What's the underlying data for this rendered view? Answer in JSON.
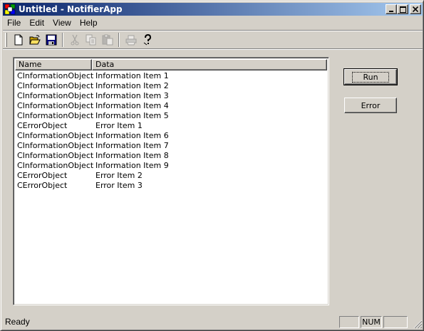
{
  "window": {
    "title": "Untitled - NotifierApp",
    "min_glyph": "_",
    "max_glyph": "□",
    "close_glyph": "✕"
  },
  "menu": [
    "File",
    "Edit",
    "View",
    "Help"
  ],
  "toolbar": {
    "buttons": [
      {
        "icon": "new-file-icon",
        "enabled": true
      },
      {
        "icon": "open-folder-icon",
        "enabled": true
      },
      {
        "icon": "save-icon",
        "enabled": true
      },
      {
        "icon": "cut-icon",
        "enabled": false
      },
      {
        "icon": "copy-icon",
        "enabled": false
      },
      {
        "icon": "paste-icon",
        "enabled": false
      },
      {
        "icon": "print-icon",
        "enabled": false
      },
      {
        "icon": "help-icon",
        "enabled": true
      }
    ]
  },
  "list": {
    "columns": [
      "Name",
      "Data"
    ],
    "rows": [
      [
        "CInformationObject",
        "Information Item 1"
      ],
      [
        "CInformationObject",
        "Information Item 2"
      ],
      [
        "CInformationObject",
        "Information Item 3"
      ],
      [
        "CInformationObject",
        "Information Item 4"
      ],
      [
        "CInformationObject",
        "Information Item 5"
      ],
      [
        "CErrorObject",
        "Error Item 1"
      ],
      [
        "CInformationObject",
        "Information Item 6"
      ],
      [
        "CInformationObject",
        "Information Item 7"
      ],
      [
        "CInformationObject",
        "Information Item 8"
      ],
      [
        "CInformationObject",
        "Information Item 9"
      ],
      [
        "CErrorObject",
        "Error Item 2"
      ],
      [
        "CErrorObject",
        "Error Item 3"
      ]
    ]
  },
  "buttons": {
    "run": "Run",
    "error": "Error"
  },
  "status": {
    "text": "Ready",
    "panel1": "",
    "panel2": "NUM",
    "panel3": ""
  },
  "colors": {
    "face": "#d4d0c8",
    "title_start": "#0a246a",
    "title_end": "#a6caf0"
  }
}
